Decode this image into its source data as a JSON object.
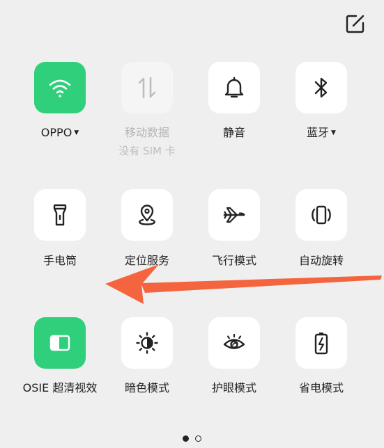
{
  "tiles": [
    {
      "label": "OPPO",
      "icon": "wifi-icon",
      "state": "on",
      "dropdown": true
    },
    {
      "label": "移动数据",
      "sublabel": "没有 SIM 卡",
      "icon": "mobile-data-icon",
      "state": "disabled"
    },
    {
      "label": "静音",
      "icon": "bell-icon",
      "state": "off"
    },
    {
      "label": "蓝牙",
      "icon": "bluetooth-icon",
      "state": "off",
      "dropdown": true
    },
    {
      "label": "手电筒",
      "icon": "flashlight-icon",
      "state": "off"
    },
    {
      "label": "定位服务",
      "icon": "location-icon",
      "state": "off"
    },
    {
      "label": "飞行模式",
      "icon": "airplane-icon",
      "state": "off"
    },
    {
      "label": "自动旋转",
      "icon": "auto-rotate-icon",
      "state": "off"
    },
    {
      "label": "OSIE 超清视效",
      "icon": "osie-icon",
      "state": "on"
    },
    {
      "label": "暗色模式",
      "icon": "dark-mode-icon",
      "state": "off"
    },
    {
      "label": "护眼模式",
      "icon": "eye-icon",
      "state": "off"
    },
    {
      "label": "省电模式",
      "icon": "battery-saver-icon",
      "state": "off"
    }
  ],
  "pager": {
    "pages": 2,
    "current": 1
  },
  "colors": {
    "active_tile": "#2fcf7b",
    "background": "#efefef",
    "swipe_arrow": "#f4653f"
  },
  "annotation": {
    "type": "swipe-left-arrow"
  }
}
